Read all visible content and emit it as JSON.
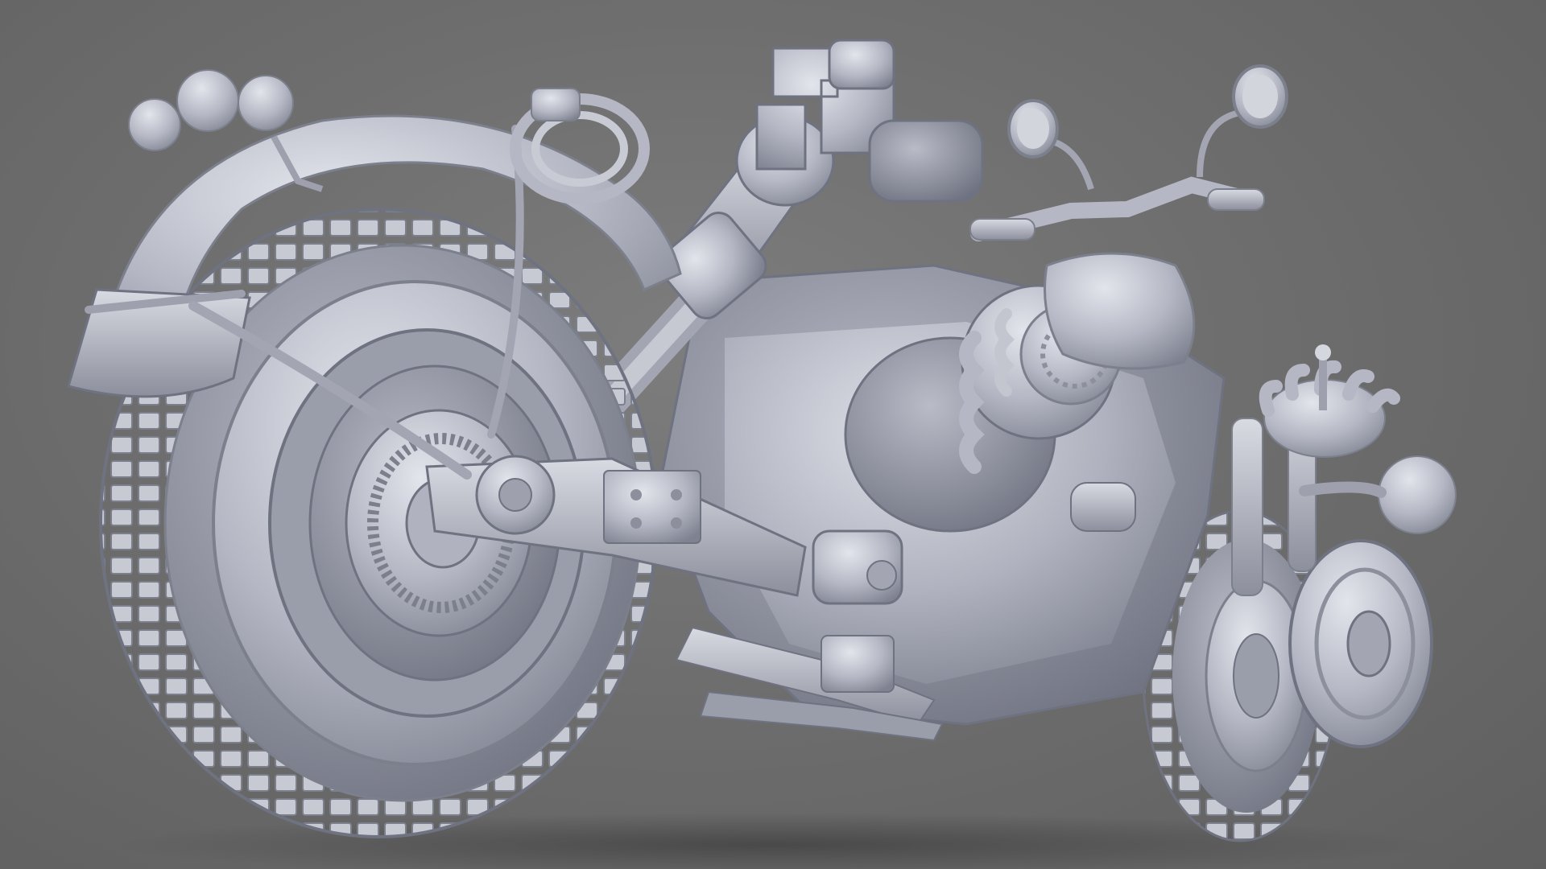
{
  "scene": {
    "subject": "motorcycle-render",
    "colors": {
      "background": "#6e6e6e",
      "clay": "#b9bcc7",
      "clay_light": "#dfe1e8",
      "clay_mid": "#a3a6b2",
      "clay_shadow": "#7c7f8c",
      "ground_shadow": "#4e4e4e"
    }
  }
}
